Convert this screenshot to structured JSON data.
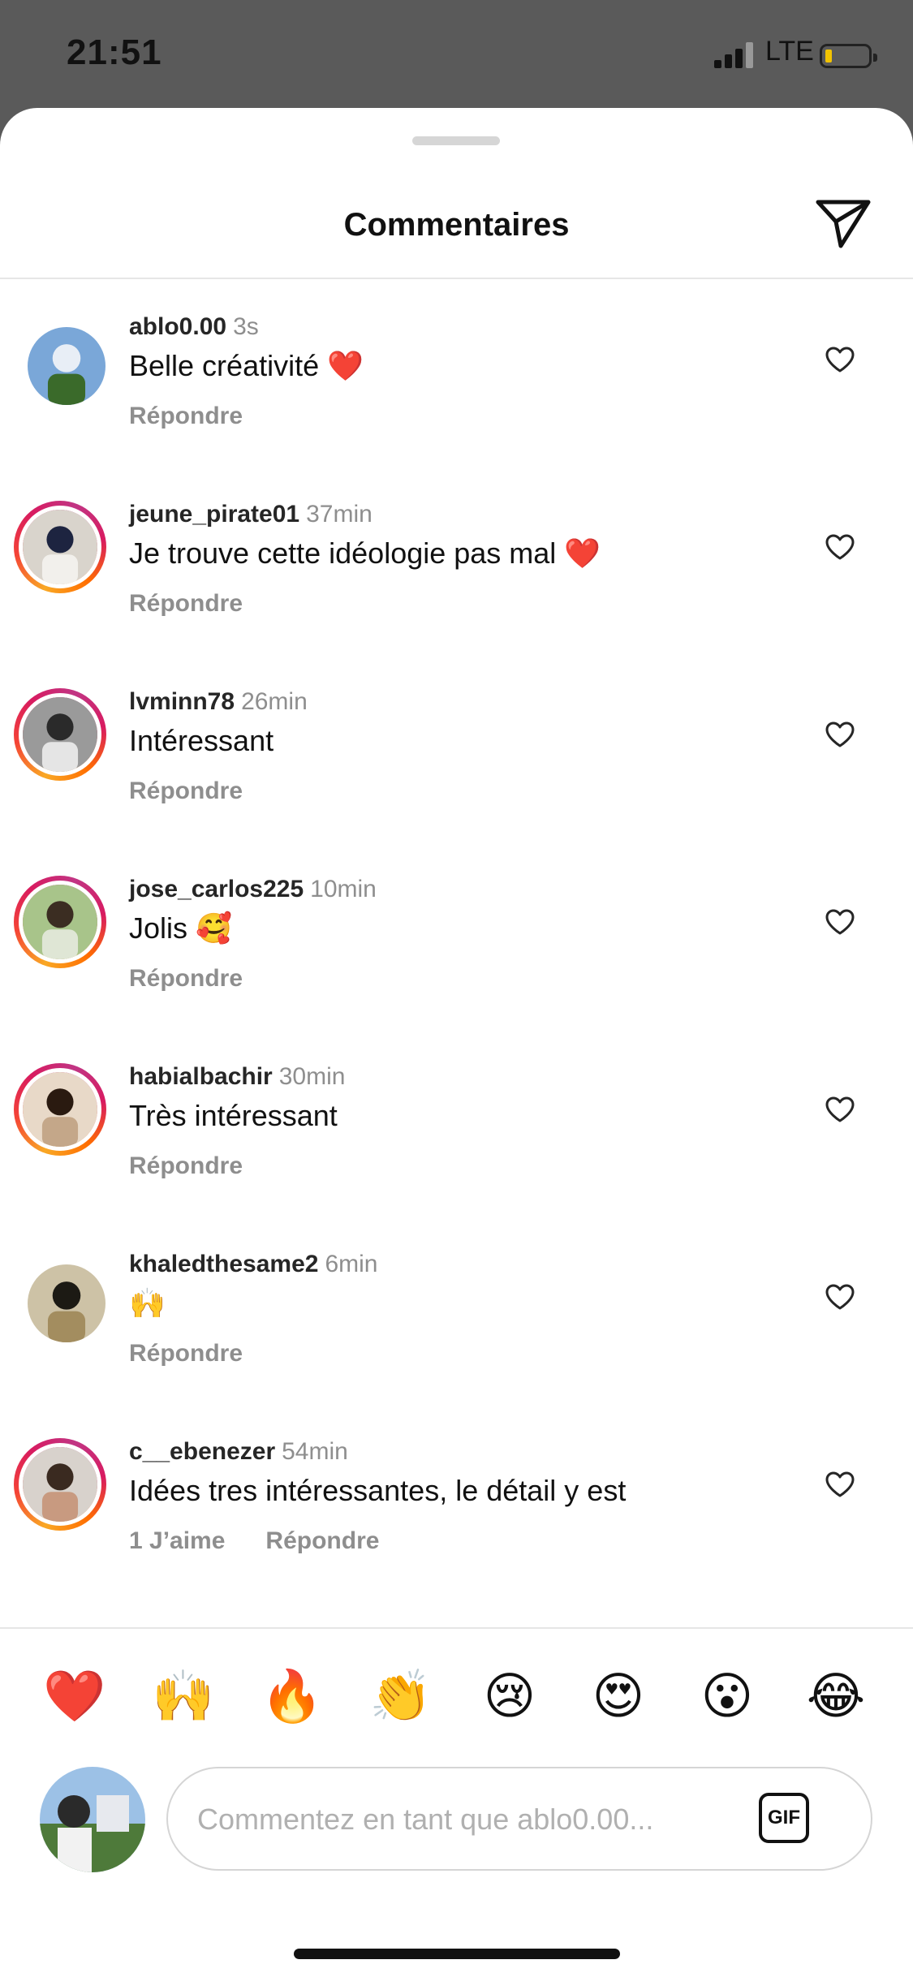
{
  "status_bar": {
    "time": "21:51",
    "network": "LTE"
  },
  "header": {
    "title": "Commentaires"
  },
  "comments": [
    {
      "username": "ablo0.00",
      "time": "3s",
      "text": "Belle créativité ❤️",
      "likes": "",
      "reply": "Répondre",
      "story_ring": false,
      "avatar_colors": [
        "#7aa7d8",
        "#e8eef6",
        "#3a6a2a"
      ]
    },
    {
      "username": "jeune_pirate01",
      "time": "37min",
      "text": "Je trouve cette idéologie pas mal ❤️",
      "likes": "",
      "reply": "Répondre",
      "story_ring": true,
      "avatar_colors": [
        "#d9d4cc",
        "#1d2440",
        "#f2f0ec"
      ]
    },
    {
      "username": "lvminn78",
      "time": "26min",
      "text": "Intéressant",
      "likes": "",
      "reply": "Répondre",
      "story_ring": true,
      "avatar_colors": [
        "#9a9a9a",
        "#2a2a2a",
        "#e5e5e5"
      ]
    },
    {
      "username": "jose_carlos225",
      "time": "10min",
      "text": "Jolis 🥰",
      "likes": "",
      "reply": "Répondre",
      "story_ring": true,
      "avatar_colors": [
        "#a8c48a",
        "#3b2d22",
        "#dfe6d5"
      ]
    },
    {
      "username": "habialbachir",
      "time": "30min",
      "text": "Très intéressant",
      "likes": "",
      "reply": "Répondre",
      "story_ring": true,
      "avatar_colors": [
        "#e8d9c8",
        "#2a1a10",
        "#c4a789"
      ]
    },
    {
      "username": "khaledthesame2",
      "time": "6min",
      "text": "🙌",
      "likes": "",
      "reply": "Répondre",
      "story_ring": false,
      "avatar_colors": [
        "#cdc2a6",
        "#1c1a14",
        "#a38d5f"
      ]
    },
    {
      "username": "c__ebenezer",
      "time": "54min",
      "text": "Idées tres intéressantes, le détail y est",
      "likes": "1 J’aime",
      "reply": "Répondre",
      "story_ring": true,
      "avatar_colors": [
        "#d8d2cc",
        "#3a2a20",
        "#c89a80"
      ]
    }
  ],
  "emoji_bar": [
    "❤️",
    "🙌",
    "🔥",
    "👏",
    "😢",
    "😍",
    "😮",
    "😂"
  ],
  "composer": {
    "placeholder": "Commentez en tant que ablo0.00...",
    "gif_label": "GIF"
  },
  "colors": {
    "like_gray": "#262626",
    "secondary_text": "#8e8e8e",
    "divider": "#e6e6e6"
  }
}
